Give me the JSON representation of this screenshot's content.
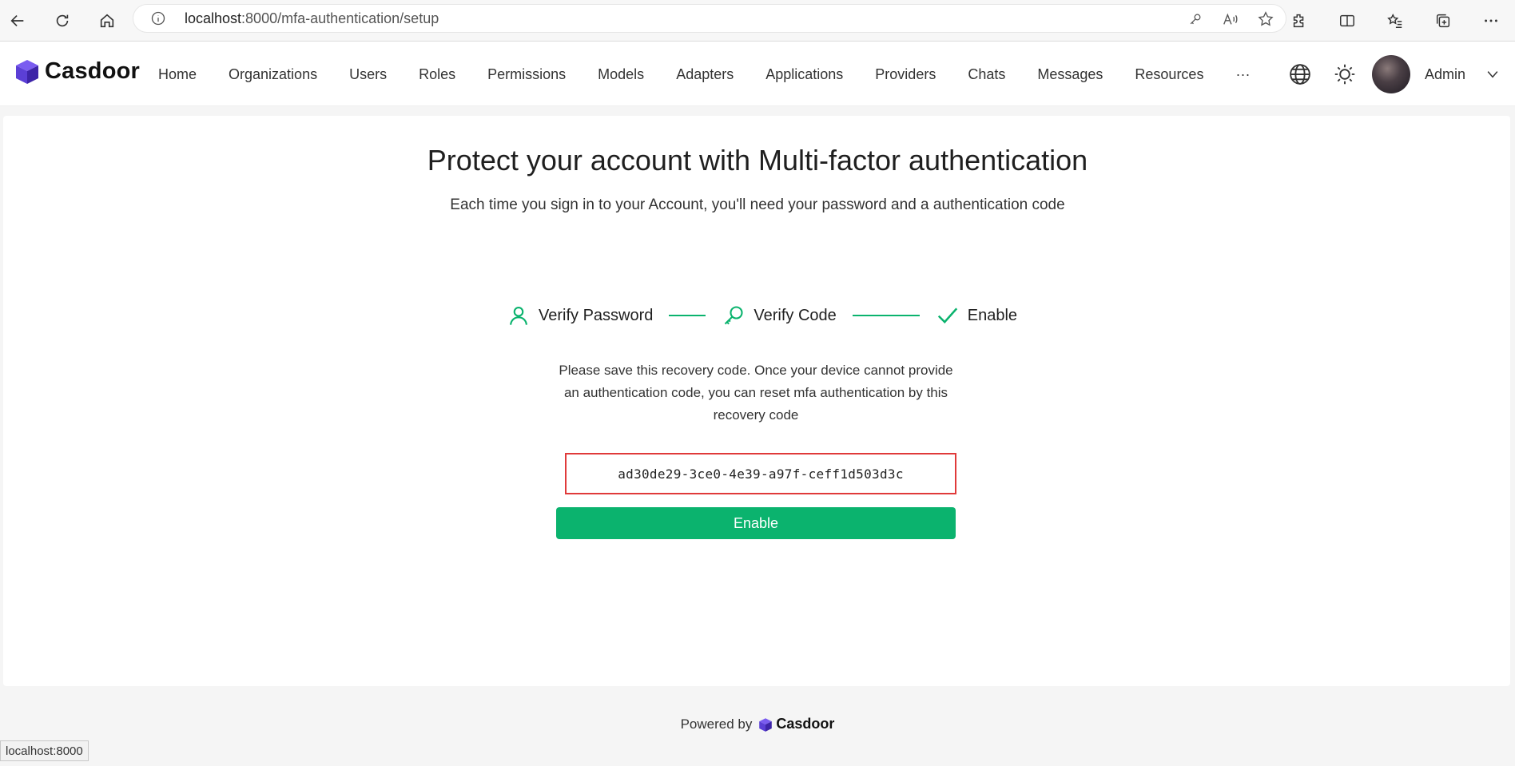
{
  "browser": {
    "url_host": "localhost",
    "url_path": ":8000/mfa-authentication/setup",
    "status_tip": "localhost:8000"
  },
  "app": {
    "brand": "Casdoor",
    "menu": [
      "Home",
      "Organizations",
      "Users",
      "Roles",
      "Permissions",
      "Models",
      "Adapters",
      "Applications",
      "Providers",
      "Chats",
      "Messages",
      "Resources",
      "···"
    ],
    "user_name": "Admin"
  },
  "mfa": {
    "title": "Protect your account with Multi-factor authentication",
    "subtitle": "Each time you sign in to your Account, you'll need your password and a authentication code",
    "steps": [
      {
        "label": "Verify Password",
        "icon": "user-icon"
      },
      {
        "label": "Verify Code",
        "icon": "key-icon"
      },
      {
        "label": "Enable",
        "icon": "check-icon"
      }
    ],
    "notice": "Please save this recovery code. Once your device cannot provide an authentication code, you can reset mfa authentication by this recovery code",
    "recovery_code": "ad30de29-3ce0-4e39-a97f-ceff1d503d3c",
    "enable_button": "Enable"
  },
  "footer": {
    "powered_by": "Powered by",
    "brand": "Casdoor"
  },
  "colors": {
    "accent": "#0bb36e",
    "highlight_border": "#e03a3a",
    "logo_purple": "#5b3fd6"
  }
}
